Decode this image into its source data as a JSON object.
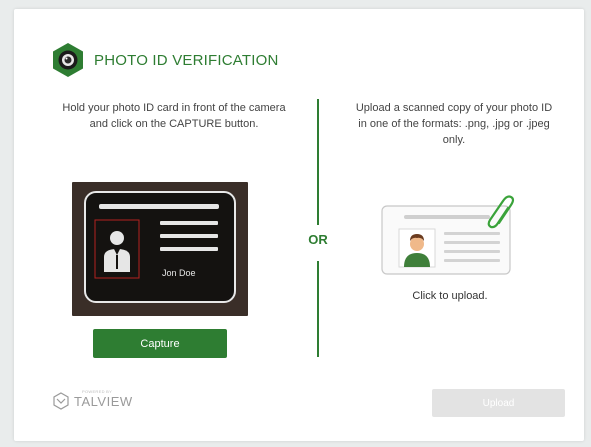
{
  "header": {
    "title": "PHOTO ID VERIFICATION",
    "logo_icon": "camera-lens-hexagon-icon"
  },
  "left_panel": {
    "instructions": "Hold your photo ID card in front of the camera and click on the CAPTURE button.",
    "id_card_name": "Jon Doe",
    "capture_label": "Capture"
  },
  "separator": {
    "label": "OR"
  },
  "right_panel": {
    "instructions": "Upload a scanned copy of your photo ID in one of the formats: .png, .jpg or .jpeg only.",
    "click_to_upload": "Click to upload."
  },
  "footer": {
    "brand": "TALVIEW",
    "powered_by": "POWERED BY",
    "upload_label": "Upload"
  },
  "colors": {
    "accent": "#2e7d32",
    "disabled_button": "#e3e3e3"
  }
}
